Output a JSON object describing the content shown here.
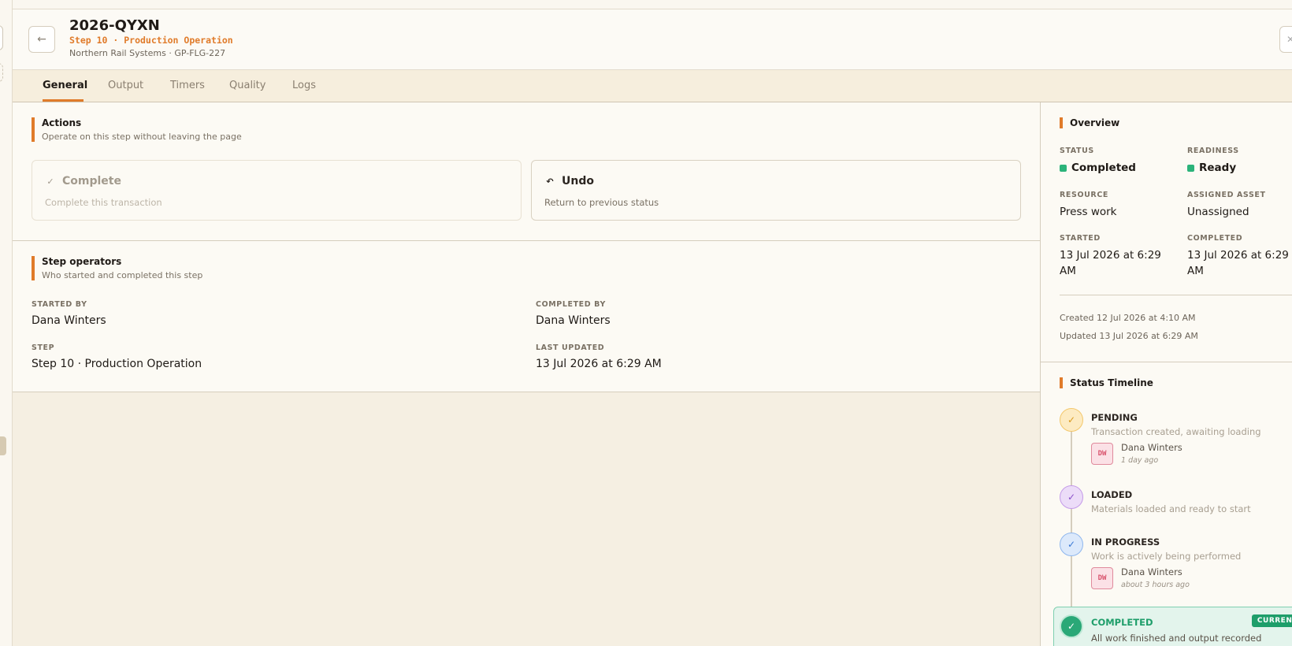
{
  "header": {
    "title": "2026-QYXN",
    "step_line": "Step 10 · Production Operation",
    "meta": "Northern Rail Systems · GP-FLG-227"
  },
  "tabs": [
    "General",
    "Output",
    "Timers",
    "Quality",
    "Logs"
  ],
  "actions": {
    "title": "Actions",
    "subtitle": "Operate on this step without leaving the page",
    "complete": {
      "label": "Complete",
      "desc": "Complete this transaction",
      "icon": "check-circle-icon"
    },
    "undo": {
      "label": "Undo",
      "desc": "Return to previous status",
      "icon": "undo-icon"
    }
  },
  "operators": {
    "title": "Step operators",
    "subtitle": "Who started and completed this step",
    "started_by_label": "STARTED BY",
    "started_by": "Dana Winters",
    "completed_by_label": "COMPLETED BY",
    "completed_by": "Dana Winters",
    "step_label": "STEP",
    "step": "Step 10 · Production Operation",
    "last_updated_label": "LAST UPDATED",
    "last_updated": "13 Jul 2026 at 6:29 AM"
  },
  "overview": {
    "title": "Overview",
    "status_label": "STATUS",
    "status": "Completed",
    "readiness_label": "READINESS",
    "readiness": "Ready",
    "resource_label": "RESOURCE",
    "resource": "Press work",
    "asset_label": "ASSIGNED ASSET",
    "asset": "Unassigned",
    "started_label": "STARTED",
    "started": "13 Jul 2026 at 6:29 AM",
    "completed_label": "COMPLETED",
    "completed": "13 Jul 2026 at 6:29 AM",
    "created": "Created 12 Jul 2026 at 4:10 AM",
    "updated": "Updated 13 Jul 2026 at 6:29 AM"
  },
  "timeline": {
    "title": "Status Timeline",
    "items": [
      {
        "name": "PENDING",
        "desc": "Transaction created, awaiting loading",
        "initials": "DW",
        "who": "Dana Winters",
        "when": "1 day ago"
      },
      {
        "name": "LOADED",
        "desc": "Materials loaded and ready to start"
      },
      {
        "name": "IN PROGRESS",
        "desc": "Work is actively being performed",
        "initials": "DW",
        "who": "Dana Winters",
        "when": "about 3 hours ago"
      },
      {
        "name": "COMPLETED",
        "desc": "All work finished and output recorded",
        "badge": "CURRENT"
      }
    ]
  },
  "colors": {
    "accent": "#e07b2a",
    "success": "#2bb37a"
  }
}
